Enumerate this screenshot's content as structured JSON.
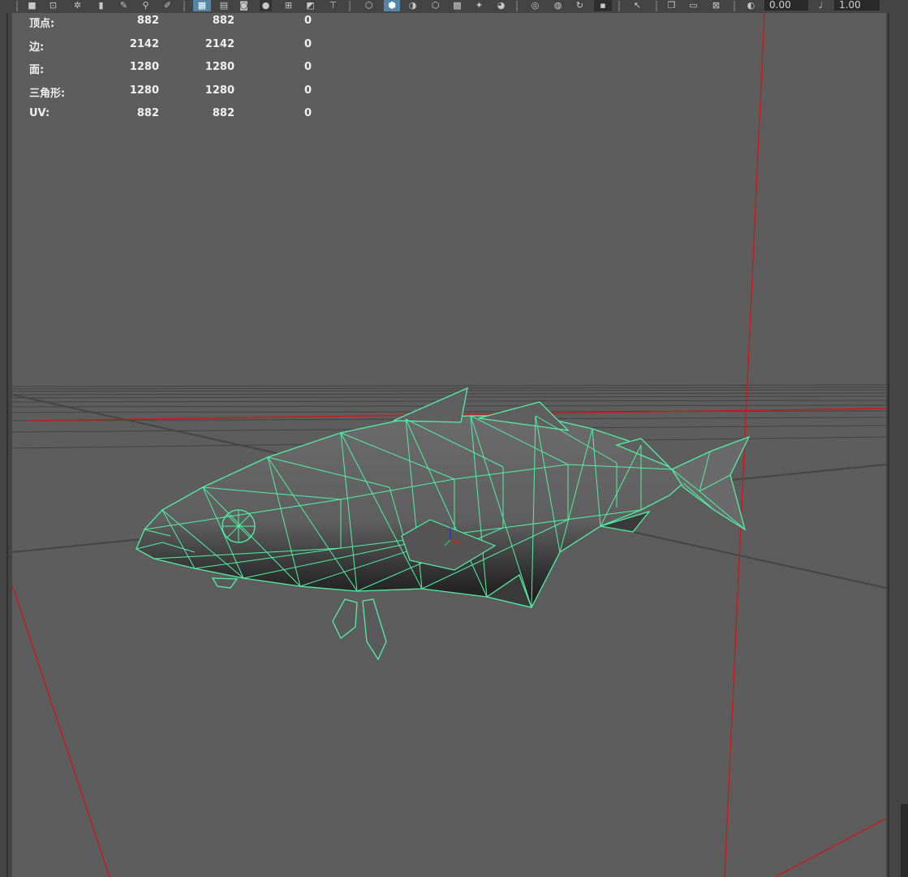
{
  "toolbar": {
    "icons": [
      "camera-icon",
      "lock-camera-icon",
      "bookmark-icon",
      "image-plane-icon",
      "grease-pencil-icon",
      "grid-icon",
      "film-gate-icon",
      "resolution-gate-icon",
      "gate-mask-icon",
      "field-chart-icon",
      "safe-action-icon",
      "safe-title-icon",
      "wireframe-icon",
      "smooth-shade-icon",
      "default-material-icon",
      "textured-icon",
      "use-all-lights-icon",
      "shadows-icon",
      "screen-space-ao-icon",
      "motion-blur-icon",
      "anti-alias-icon",
      "depth-of-field-icon",
      "isolate-select-icon",
      "xray-icon",
      "xray-joints-icon",
      "xray-components-icon",
      "gamma-icon",
      "exposure-icon"
    ],
    "exposure_value": "0.00",
    "gamma_value": "1.00"
  },
  "hud": {
    "rows": [
      {
        "label": "顶点:",
        "v1": "882",
        "v2": "882",
        "v3": "0"
      },
      {
        "label": "边:",
        "v1": "2142",
        "v2": "2142",
        "v3": "0"
      },
      {
        "label": "面:",
        "v1": "1280",
        "v2": "1280",
        "v3": "0"
      },
      {
        "label": "三角形:",
        "v1": "1280",
        "v2": "1280",
        "v3": "0"
      },
      {
        "label": "UV:",
        "v1": "882",
        "v2": "882",
        "v3": "0"
      }
    ]
  },
  "colors": {
    "viewport_bg": "#5d5d5d",
    "wireframe": "#52f0a6",
    "axis_red": "#d01818",
    "grid_line": "#3c3c3c"
  }
}
